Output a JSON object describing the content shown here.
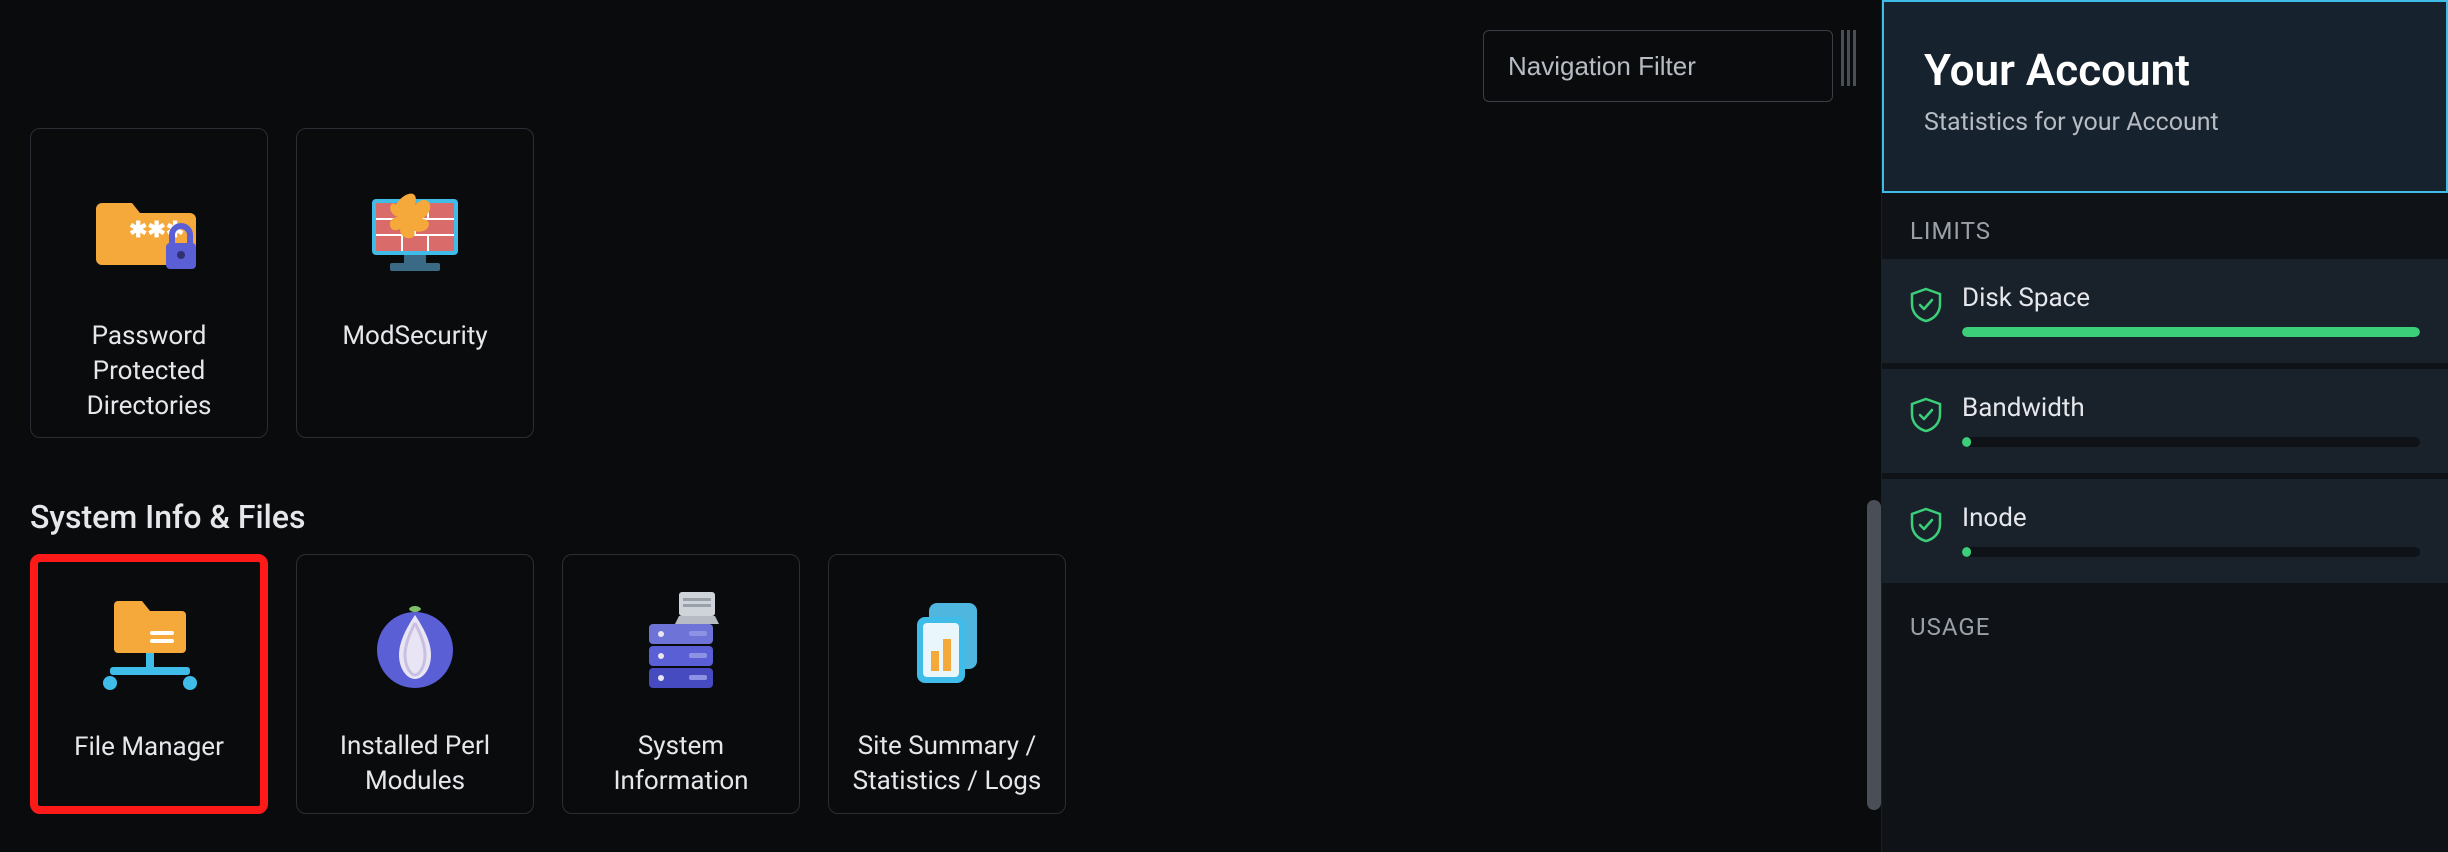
{
  "nav_filter": {
    "placeholder": "Navigation Filter",
    "value": ""
  },
  "security_tiles": [
    {
      "id": "password-protected-dirs",
      "label": "Password\nProtected\nDirectories"
    },
    {
      "id": "modsecurity",
      "label": "ModSecurity"
    }
  ],
  "section_title": "System Info & Files",
  "system_tiles": [
    {
      "id": "file-manager",
      "label": "File Manager",
      "highlighted": true
    },
    {
      "id": "installed-perl-modules",
      "label": "Installed Perl\nModules"
    },
    {
      "id": "system-information",
      "label": "System\nInformation"
    },
    {
      "id": "site-summary",
      "label": "Site Summary /\nStatistics / Logs"
    }
  ],
  "sidebar": {
    "title": "Your Account",
    "subtitle": "Statistics for your Account",
    "limits_label": "LIMITS",
    "usage_label": "USAGE",
    "limits": [
      {
        "name": "Disk Space",
        "pct": 100
      },
      {
        "name": "Bandwidth",
        "pct": 2
      },
      {
        "name": "Inode",
        "pct": 2
      }
    ]
  },
  "colors": {
    "accent": "#3fbce8",
    "ok": "#3bcf7a",
    "folder": "#f6a93b",
    "purple": "#5a5fd6"
  }
}
